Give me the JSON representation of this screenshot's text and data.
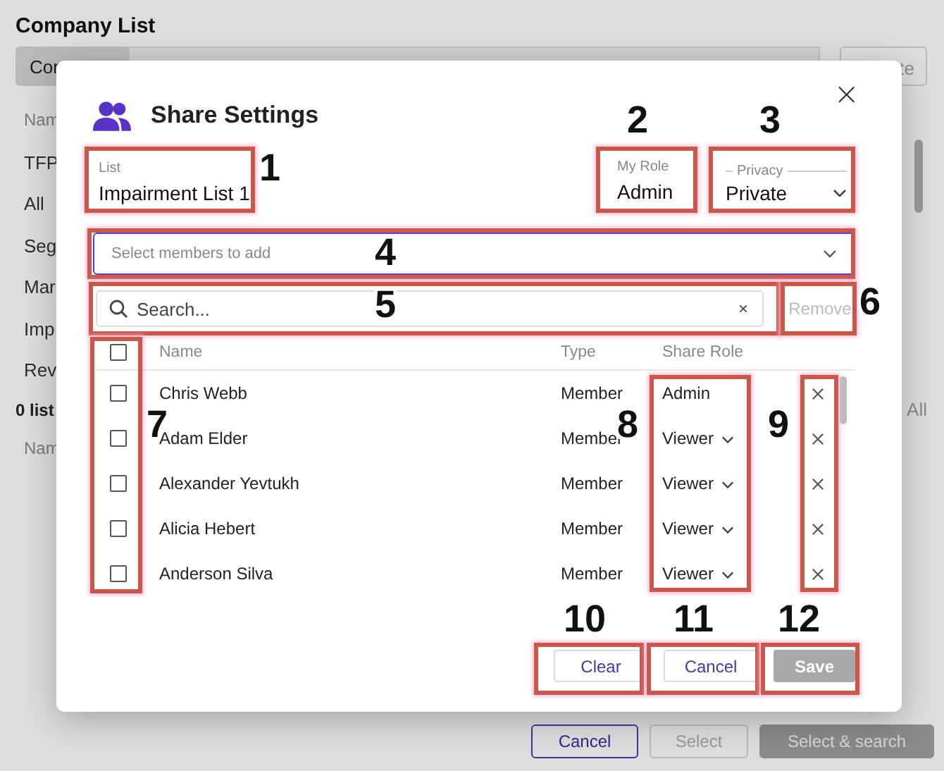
{
  "background_page": {
    "title": "Company List",
    "tab": "Con",
    "top_right_button": "te",
    "left_column": [
      "Nam",
      "TFP",
      "All",
      "Seg",
      "Mar",
      "Imp",
      "Rev"
    ],
    "count": "0 list",
    "left_header_2": "Nam",
    "right_link": "All",
    "buttons": [
      {
        "label": "Cancel",
        "kind": "outline"
      },
      {
        "label": "Select",
        "kind": "disabled"
      },
      {
        "label": "Select & search",
        "kind": "filled"
      }
    ]
  },
  "dialog": {
    "title": "Share Settings",
    "close": "×",
    "list_field": {
      "label": "List",
      "value": "Impairment List 1"
    },
    "my_role": {
      "label": "My Role",
      "value": "Admin"
    },
    "privacy": {
      "label": "Privacy",
      "value": "Private"
    },
    "members_select": {
      "placeholder": "Select members to add"
    },
    "search": {
      "placeholder": "Search...",
      "clear": "×"
    },
    "remove_button": {
      "label": "Remove",
      "disabled": true
    },
    "table": {
      "select_all_checked": false,
      "columns": [
        "Name",
        "Type",
        "Share Role"
      ],
      "rows": [
        {
          "checked": false,
          "name": "Chris Webb",
          "type": "Member",
          "role": "Admin",
          "editable": false
        },
        {
          "checked": false,
          "name": "Adam Elder",
          "type": "Member",
          "role": "Viewer",
          "editable": true
        },
        {
          "checked": false,
          "name": "Alexander Yevtukh",
          "type": "Member",
          "role": "Viewer",
          "editable": true
        },
        {
          "checked": false,
          "name": "Alicia Hebert",
          "type": "Member",
          "role": "Viewer",
          "editable": true
        },
        {
          "checked": false,
          "name": "Anderson Silva",
          "type": "Member",
          "role": "Viewer",
          "editable": true
        }
      ]
    },
    "footer_buttons": [
      {
        "label": "Clear",
        "kind": "outline"
      },
      {
        "label": "Cancel",
        "kind": "outline"
      },
      {
        "label": "Save",
        "kind": "disabled"
      }
    ]
  },
  "annotations": [
    {
      "label": "1"
    },
    {
      "label": "2"
    },
    {
      "label": "3"
    },
    {
      "label": "4"
    },
    {
      "label": "5"
    },
    {
      "label": "6"
    },
    {
      "label": "7"
    },
    {
      "label": "8"
    },
    {
      "label": "9"
    },
    {
      "label": "10"
    },
    {
      "label": "11"
    },
    {
      "label": "12"
    }
  ]
}
